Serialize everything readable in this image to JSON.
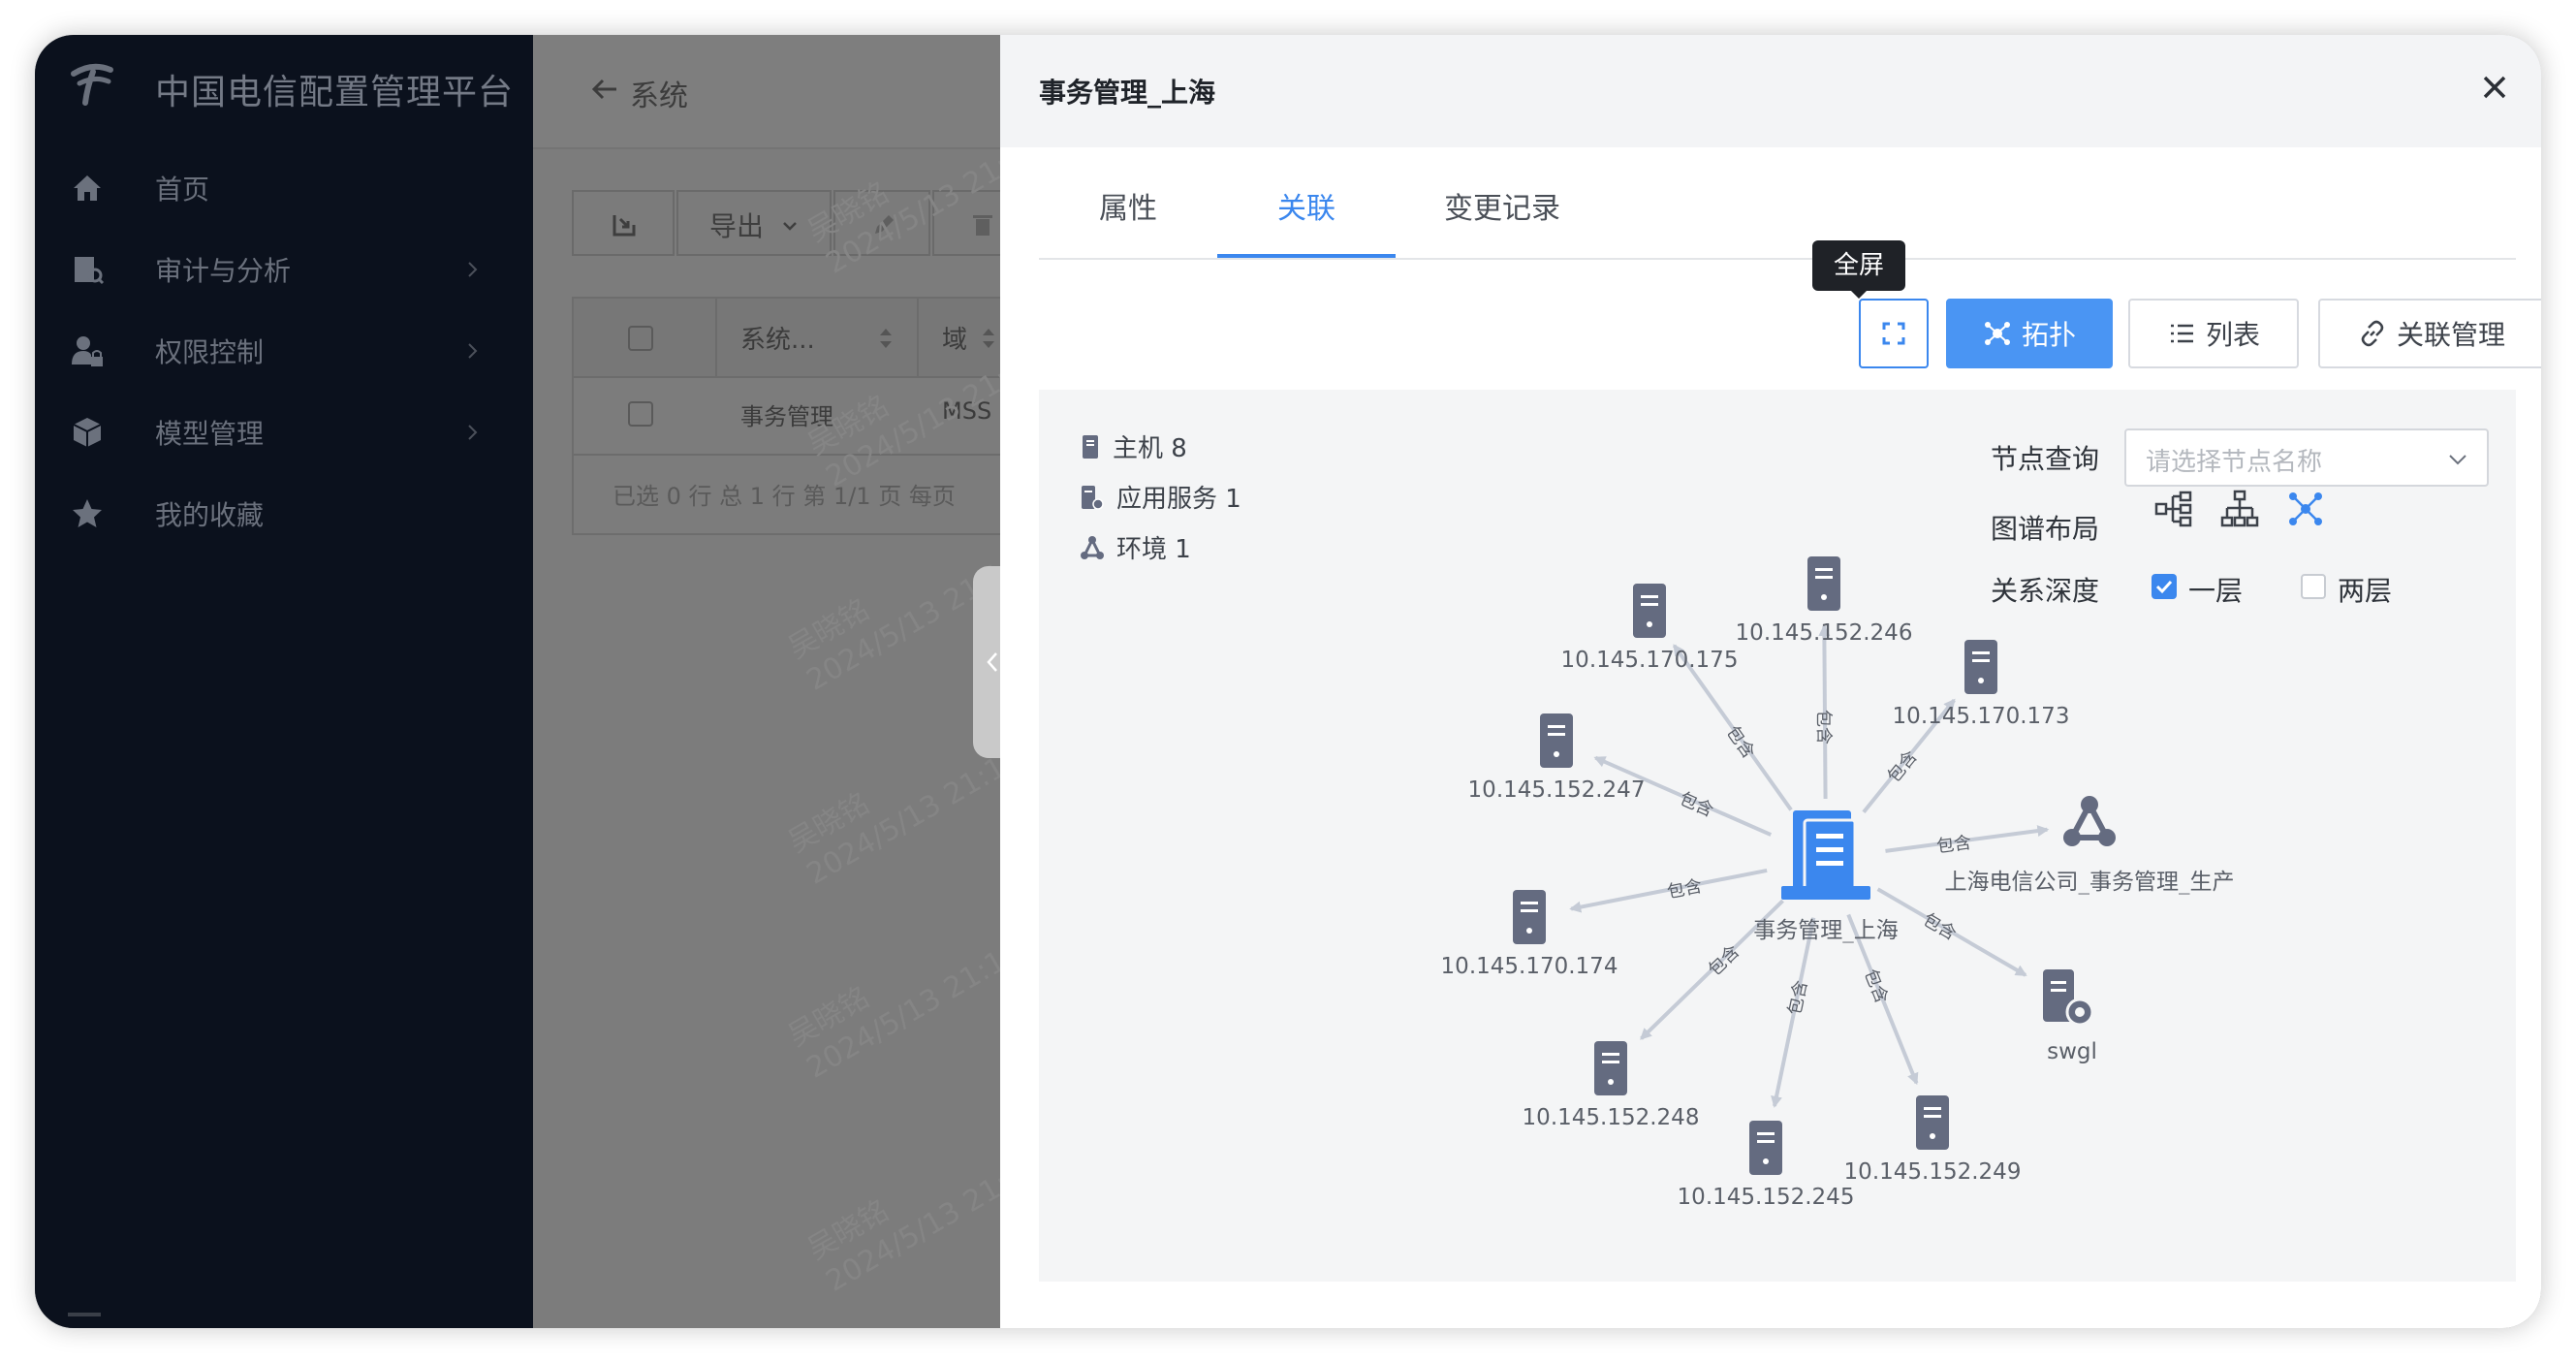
{
  "app": {
    "title": "中国电信配置管理平台",
    "nav": [
      {
        "label": "首页",
        "icon": "home-icon"
      },
      {
        "label": "审计与分析",
        "icon": "audit-icon"
      },
      {
        "label": "权限控制",
        "icon": "user-lock-icon"
      },
      {
        "label": "模型管理",
        "icon": "cube-icon"
      },
      {
        "label": "我的收藏",
        "icon": "star-icon"
      }
    ]
  },
  "main": {
    "back_title": "系统",
    "toolbar": {
      "export_label": "导出"
    },
    "table": {
      "headers": [
        "系统...",
        "域"
      ],
      "rows": [
        [
          "事务管理",
          "MSS"
        ]
      ]
    },
    "pager": "已选 0 行   总 1 行   第 1/1 页   每页",
    "watermark_name": "吴晓铭",
    "watermark_time": "2024/5/13 21:11:29"
  },
  "drawer": {
    "title": "事务管理_上海",
    "tabs": [
      {
        "label": "属性",
        "active": false
      },
      {
        "label": "关联",
        "active": true
      },
      {
        "label": "变更记录",
        "active": false
      }
    ],
    "tooltip": "全屏",
    "buttons": {
      "topology": "拓扑",
      "list": "列表",
      "relation_manage": "关联管理"
    },
    "legend": [
      {
        "label": "主机 8",
        "icon": "server-icon"
      },
      {
        "label": "应用服务 1",
        "icon": "app-service-icon"
      },
      {
        "label": "环境 1",
        "icon": "environment-icon"
      }
    ],
    "controls": {
      "node_query_label": "节点查询",
      "node_query_placeholder": "请选择节点名称",
      "layout_label": "图谱布局",
      "depth_label": "关系深度",
      "depth_one": "一层",
      "depth_two": "两层",
      "depth_one_checked": true,
      "depth_two_checked": false
    },
    "graph": {
      "center": "事务管理_上海",
      "edge_label": "包含",
      "nodes": [
        {
          "label": "10.145.170.175",
          "type": "server"
        },
        {
          "label": "10.145.152.246",
          "type": "server"
        },
        {
          "label": "10.145.170.173",
          "type": "server"
        },
        {
          "label": "10.145.152.247",
          "type": "server"
        },
        {
          "label": "上海电信公司_事务管理_生产",
          "type": "environment"
        },
        {
          "label": "10.145.170.174",
          "type": "server"
        },
        {
          "label": "swgl",
          "type": "app-service"
        },
        {
          "label": "10.145.152.248",
          "type": "server"
        },
        {
          "label": "10.145.152.245",
          "type": "server"
        },
        {
          "label": "10.145.152.249",
          "type": "server"
        }
      ]
    }
  },
  "colors": {
    "accent": "#3b87ee",
    "sidebar": "#0b111d",
    "node_icon": "#646b80",
    "edge": "#c5cbd6"
  }
}
